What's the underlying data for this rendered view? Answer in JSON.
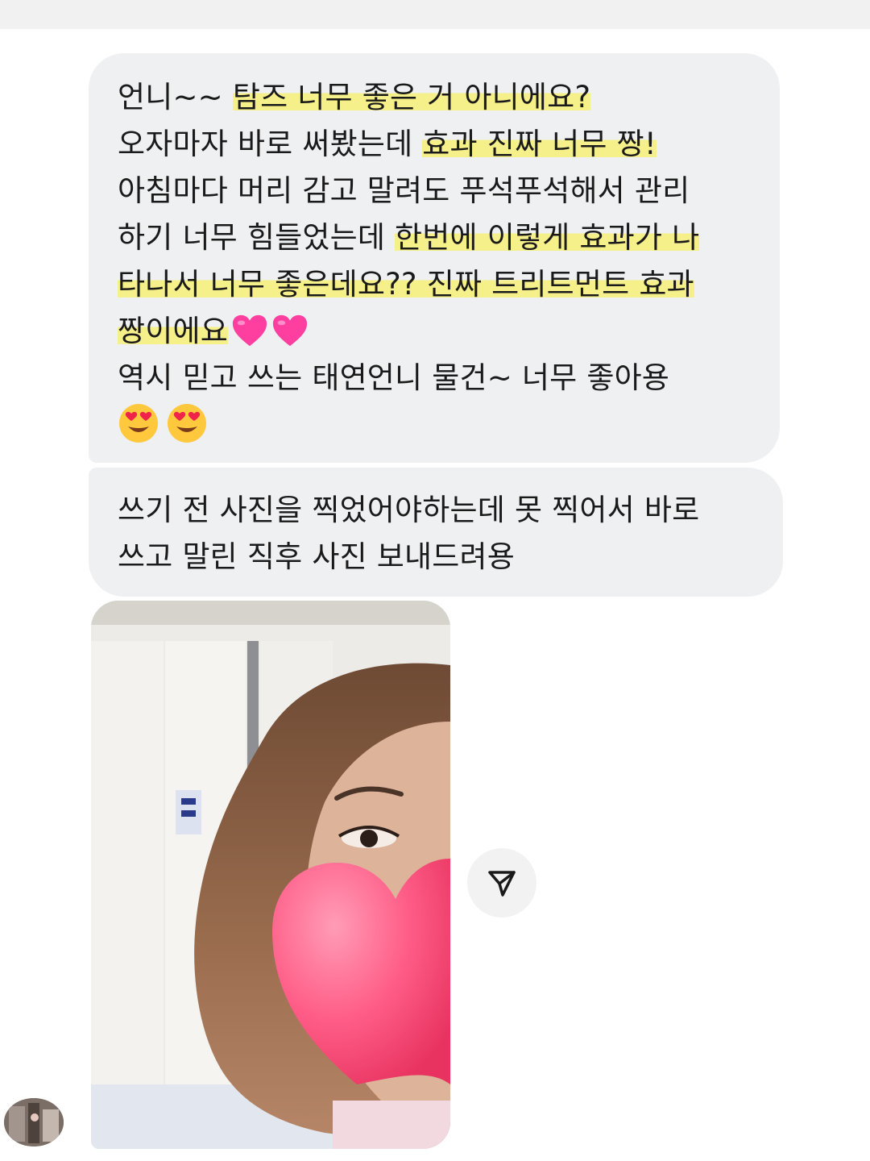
{
  "message1": {
    "lines": [
      {
        "plain": "언니~~ ",
        "highlight": "탐즈 너무 좋은 거 아니에요?",
        "tail": ""
      },
      {
        "plain": "오자마자 바로 써봤는데 ",
        "highlight": "효과 진짜 너무 짱!",
        "tail": ""
      },
      {
        "plain": "아침마다 머리 감고 말려도 푸석푸석해서 관리",
        "highlight": "",
        "tail": ""
      },
      {
        "plain": "하기 너무 힘들었는데 ",
        "highlight": "한번에 이렇게 효과가 나",
        "tail": ""
      },
      {
        "plain": "",
        "highlight": "타나서 너무 좋은데요?? 진짜 트리트먼트 효과",
        "tail": ""
      },
      {
        "plain": "짱이에요",
        "highlight": "",
        "tail": ""
      },
      {
        "plain": "역시 믿고 쓰는 태연언니 물건~ 너무 좋아용",
        "highlight": "",
        "tail": ""
      }
    ],
    "line6_emojis": [
      "pink-heart-icon",
      "pink-heart-icon"
    ],
    "line8_emojis": [
      "heart-eyes-face-icon",
      "heart-eyes-face-icon"
    ],
    "highlight_color": "#f8f078"
  },
  "message2": {
    "lines": [
      "쓰기 전 사진을 찍었어야하는데 못 찍어서 바로",
      "쓰고 말린 직후 사진 보내드려용"
    ]
  },
  "photo": {
    "description_icon": "photo-with-heart-sticker",
    "sticker": "pink-heart-sticker"
  },
  "share_icon": "paper-plane-icon",
  "colors": {
    "bubble": "#eef0f2",
    "heart": "#ff4f86",
    "highlight": "#f8f078"
  }
}
